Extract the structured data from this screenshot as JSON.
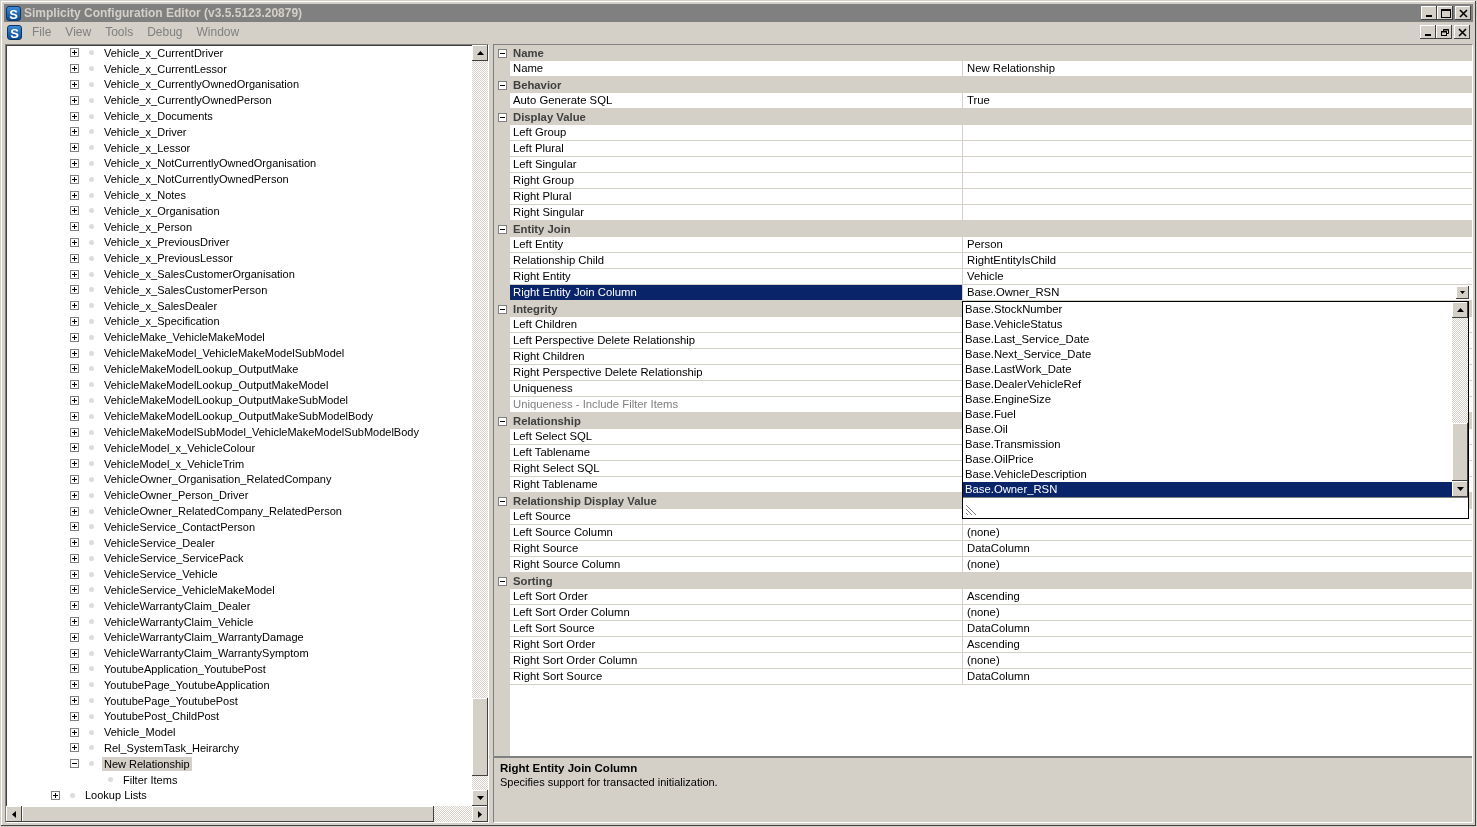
{
  "window": {
    "icon_letter": "S",
    "title": "Simplicity Configuration Editor (v3.5.5123.20879)"
  },
  "menu_bar": {
    "icon_letter": "S",
    "items": [
      "File",
      "View",
      "Tools",
      "Debug",
      "Window"
    ]
  },
  "tree": {
    "items_of_scrolled_parent": [
      {
        "label": "Vehicle_x_CurrentDriver",
        "expanded": false,
        "selected": false
      },
      {
        "label": "Vehicle_x_CurrentLessor",
        "expanded": false,
        "selected": false
      },
      {
        "label": "Vehicle_x_CurrentlyOwnedOrganisation",
        "expanded": false,
        "selected": false
      },
      {
        "label": "Vehicle_x_CurrentlyOwnedPerson",
        "expanded": false,
        "selected": false
      },
      {
        "label": "Vehicle_x_Documents",
        "expanded": false,
        "selected": false
      },
      {
        "label": "Vehicle_x_Driver",
        "expanded": false,
        "selected": false
      },
      {
        "label": "Vehicle_x_Lessor",
        "expanded": false,
        "selected": false
      },
      {
        "label": "Vehicle_x_NotCurrentlyOwnedOrganisation",
        "expanded": false,
        "selected": false
      },
      {
        "label": "Vehicle_x_NotCurrentlyOwnedPerson",
        "expanded": false,
        "selected": false
      },
      {
        "label": "Vehicle_x_Notes",
        "expanded": false,
        "selected": false
      },
      {
        "label": "Vehicle_x_Organisation",
        "expanded": false,
        "selected": false
      },
      {
        "label": "Vehicle_x_Person",
        "expanded": false,
        "selected": false
      },
      {
        "label": "Vehicle_x_PreviousDriver",
        "expanded": false,
        "selected": false
      },
      {
        "label": "Vehicle_x_PreviousLessor",
        "expanded": false,
        "selected": false
      },
      {
        "label": "Vehicle_x_SalesCustomerOrganisation",
        "expanded": false,
        "selected": false
      },
      {
        "label": "Vehicle_x_SalesCustomerPerson",
        "expanded": false,
        "selected": false
      },
      {
        "label": "Vehicle_x_SalesDealer",
        "expanded": false,
        "selected": false
      },
      {
        "label": "Vehicle_x_Specification",
        "expanded": false,
        "selected": false
      },
      {
        "label": "VehicleMake_VehicleMakeModel",
        "expanded": false,
        "selected": false
      },
      {
        "label": "VehicleMakeModel_VehicleMakeModelSubModel",
        "expanded": false,
        "selected": false
      },
      {
        "label": "VehicleMakeModelLookup_OutputMake",
        "expanded": false,
        "selected": false
      },
      {
        "label": "VehicleMakeModelLookup_OutputMakeModel",
        "expanded": false,
        "selected": false
      },
      {
        "label": "VehicleMakeModelLookup_OutputMakeSubModel",
        "expanded": false,
        "selected": false
      },
      {
        "label": "VehicleMakeModelLookup_OutputMakeSubModelBody",
        "expanded": false,
        "selected": false
      },
      {
        "label": "VehicleMakeModelSubModel_VehicleMakeModelSubModelBody",
        "expanded": false,
        "selected": false
      },
      {
        "label": "VehicleModel_x_VehicleColour",
        "expanded": false,
        "selected": false
      },
      {
        "label": "VehicleModel_x_VehicleTrim",
        "expanded": false,
        "selected": false
      },
      {
        "label": "VehicleOwner_Organisation_RelatedCompany",
        "expanded": false,
        "selected": false
      },
      {
        "label": "VehicleOwner_Person_Driver",
        "expanded": false,
        "selected": false
      },
      {
        "label": "VehicleOwner_RelatedCompany_RelatedPerson",
        "expanded": false,
        "selected": false
      },
      {
        "label": "VehicleService_ContactPerson",
        "expanded": false,
        "selected": false
      },
      {
        "label": "VehicleService_Dealer",
        "expanded": false,
        "selected": false
      },
      {
        "label": "VehicleService_ServicePack",
        "expanded": false,
        "selected": false
      },
      {
        "label": "VehicleService_Vehicle",
        "expanded": false,
        "selected": false
      },
      {
        "label": "VehicleService_VehicleMakeModel",
        "expanded": false,
        "selected": false
      },
      {
        "label": "VehicleWarrantyClaim_Dealer",
        "expanded": false,
        "selected": false
      },
      {
        "label": "VehicleWarrantyClaim_Vehicle",
        "expanded": false,
        "selected": false
      },
      {
        "label": "VehicleWarrantyClaim_WarrantyDamage",
        "expanded": false,
        "selected": false
      },
      {
        "label": "VehicleWarrantyClaim_WarrantySymptom",
        "expanded": false,
        "selected": false
      },
      {
        "label": "YoutubeApplication_YoutubePost",
        "expanded": false,
        "selected": false
      },
      {
        "label": "YoutubePage_YoutubeApplication",
        "expanded": false,
        "selected": false
      },
      {
        "label": "YoutubePage_YoutubePost",
        "expanded": false,
        "selected": false
      },
      {
        "label": "YoutubePost_ChildPost",
        "expanded": false,
        "selected": false
      },
      {
        "label": "Vehicle_Model",
        "expanded": false,
        "selected": false
      },
      {
        "label": "Rel_SystemTask_Heirarchy",
        "expanded": false,
        "selected": false
      },
      {
        "label": "New Relationship",
        "expanded": true,
        "selected": true,
        "children": [
          {
            "label": "Filter Items",
            "selected": false
          }
        ]
      }
    ],
    "root_items": [
      {
        "label": "Lookup Lists",
        "expanded": false,
        "selected": false
      }
    ]
  },
  "properties": {
    "categories": [
      {
        "label": "Name",
        "expanded": true,
        "rows": [
          {
            "name": "Name",
            "value": "New Relationship",
            "selected": false,
            "disabled": false
          }
        ]
      },
      {
        "label": "Behavior",
        "expanded": true,
        "rows": [
          {
            "name": "Auto Generate SQL",
            "value": "True",
            "selected": false,
            "disabled": false
          }
        ]
      },
      {
        "label": "Display Value",
        "expanded": true,
        "rows": [
          {
            "name": "Left Group",
            "selected": false,
            "disabled": false
          },
          {
            "name": "Left Plural",
            "selected": false,
            "disabled": false
          },
          {
            "name": "Left Singular",
            "selected": false,
            "disabled": false
          },
          {
            "name": "Right Group",
            "selected": false,
            "disabled": false
          },
          {
            "name": "Right Plural",
            "selected": false,
            "disabled": false
          },
          {
            "name": "Right Singular",
            "selected": false,
            "disabled": false
          }
        ]
      },
      {
        "label": "Entity Join",
        "expanded": true,
        "rows": [
          {
            "name": "Left Entity",
            "value": "Person",
            "selected": false,
            "disabled": false
          },
          {
            "name": "Relationship Child",
            "value": "RightEntityIsChild",
            "selected": false,
            "disabled": false
          },
          {
            "name": "Right Entity",
            "value": "Vehicle",
            "selected": false,
            "disabled": false
          },
          {
            "name": "Right Entity Join Column",
            "value": "Base.Owner_RSN",
            "selected": true,
            "disabled": false,
            "kind": "dropdown"
          }
        ]
      },
      {
        "label": "Integrity",
        "expanded": true,
        "rows": [
          {
            "name": "Left Children",
            "selected": false,
            "disabled": false
          },
          {
            "name": "Left Perspective Delete Relationship",
            "selected": false,
            "disabled": false
          },
          {
            "name": "Right Children",
            "selected": false,
            "disabled": false
          },
          {
            "name": "Right Perspective Delete Relationship",
            "selected": false,
            "disabled": false
          },
          {
            "name": "Uniqueness",
            "selected": false,
            "disabled": false
          },
          {
            "name": "Uniqueness - Include Filter Items",
            "selected": false,
            "disabled": true
          }
        ]
      },
      {
        "label": "Relationship",
        "expanded": true,
        "rows": [
          {
            "name": "Left Select SQL",
            "selected": false,
            "disabled": false
          },
          {
            "name": "Left Tablename",
            "selected": false,
            "disabled": false
          },
          {
            "name": "Right Select SQL",
            "selected": false,
            "disabled": false
          },
          {
            "name": "Right Tablename",
            "selected": false,
            "disabled": false
          }
        ]
      },
      {
        "label": "Relationship Display Value",
        "expanded": true,
        "rows": [
          {
            "name": "Left Source",
            "selected": false,
            "disabled": false
          },
          {
            "name": "Left Source Column",
            "value": "(none)",
            "selected": false,
            "disabled": false
          },
          {
            "name": "Right Source",
            "value": "DataColumn",
            "selected": false,
            "disabled": false
          },
          {
            "name": "Right Source Column",
            "value": "(none)",
            "selected": false,
            "disabled": false
          }
        ]
      },
      {
        "label": "Sorting",
        "expanded": true,
        "rows": [
          {
            "name": "Left Sort Order",
            "value": "Ascending",
            "selected": false,
            "disabled": false
          },
          {
            "name": "Left Sort Order Column",
            "value": "(none)",
            "selected": false,
            "disabled": false
          },
          {
            "name": "Left Sort Source",
            "value": "DataColumn",
            "selected": false,
            "disabled": false
          },
          {
            "name": "Right Sort Order",
            "value": "Ascending",
            "selected": false,
            "disabled": false
          },
          {
            "name": "Right Sort Order Column",
            "value": "(none)",
            "selected": false,
            "disabled": false
          },
          {
            "name": "Right Sort Source",
            "value": "DataColumn",
            "selected": false,
            "disabled": false
          }
        ]
      }
    ]
  },
  "dropdown": {
    "items": [
      {
        "label": "Base.StockNumber",
        "selected": false
      },
      {
        "label": "Base.VehicleStatus",
        "selected": false
      },
      {
        "label": "Base.Last_Service_Date",
        "selected": false
      },
      {
        "label": "Base.Next_Service_Date",
        "selected": false
      },
      {
        "label": "Base.LastWork_Date",
        "selected": false
      },
      {
        "label": "Base.DealerVehicleRef",
        "selected": false
      },
      {
        "label": "Base.EngineSize",
        "selected": false
      },
      {
        "label": "Base.Fuel",
        "selected": false
      },
      {
        "label": "Base.Oil",
        "selected": false
      },
      {
        "label": "Base.Transmission",
        "selected": false
      },
      {
        "label": "Base.OilPrice",
        "selected": false
      },
      {
        "label": "Base.VehicleDescription",
        "selected": false
      },
      {
        "label": "Base.Owner_RSN",
        "selected": true
      }
    ]
  },
  "description": {
    "title": "Right Entity Join Column",
    "text": "Specifies support for transacted initialization."
  }
}
